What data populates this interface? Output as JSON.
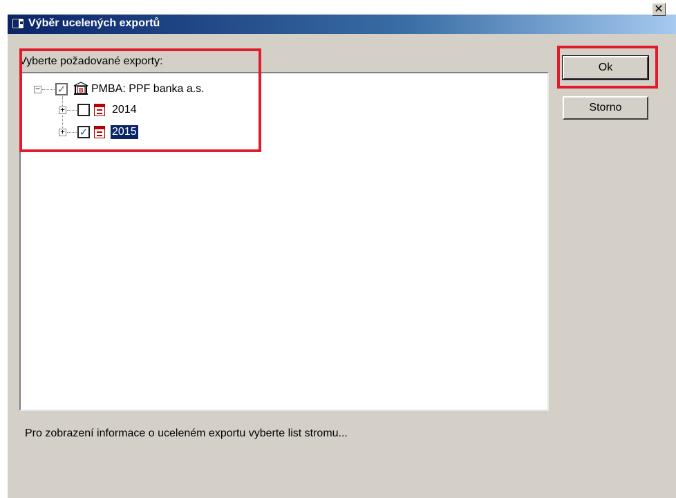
{
  "window": {
    "title": "Výběr ucelených exportů",
    "close_glyph": "✕"
  },
  "tree": {
    "prompt": "Vyberte požadované exporty:",
    "root": {
      "label": "PMBA: PPF banka a.s.",
      "expanded": true,
      "checked": true,
      "icon": "bank-icon"
    },
    "children": [
      {
        "label": "2014",
        "expanded": false,
        "checked": false,
        "selected": false,
        "icon": "calendar-icon"
      },
      {
        "label": "2015",
        "expanded": false,
        "checked": true,
        "selected": true,
        "icon": "calendar-icon"
      }
    ]
  },
  "buttons": {
    "ok": "Ok",
    "cancel": "Storno"
  },
  "status": "Pro zobrazení informace o uceleném exportu vyberte list stromu...",
  "colors": {
    "highlight": "#e01c2c",
    "selection": "#0a246a",
    "titlebar": "#0a246a"
  },
  "glyphs": {
    "collapse": "−",
    "expand": "+",
    "check": "✓"
  }
}
